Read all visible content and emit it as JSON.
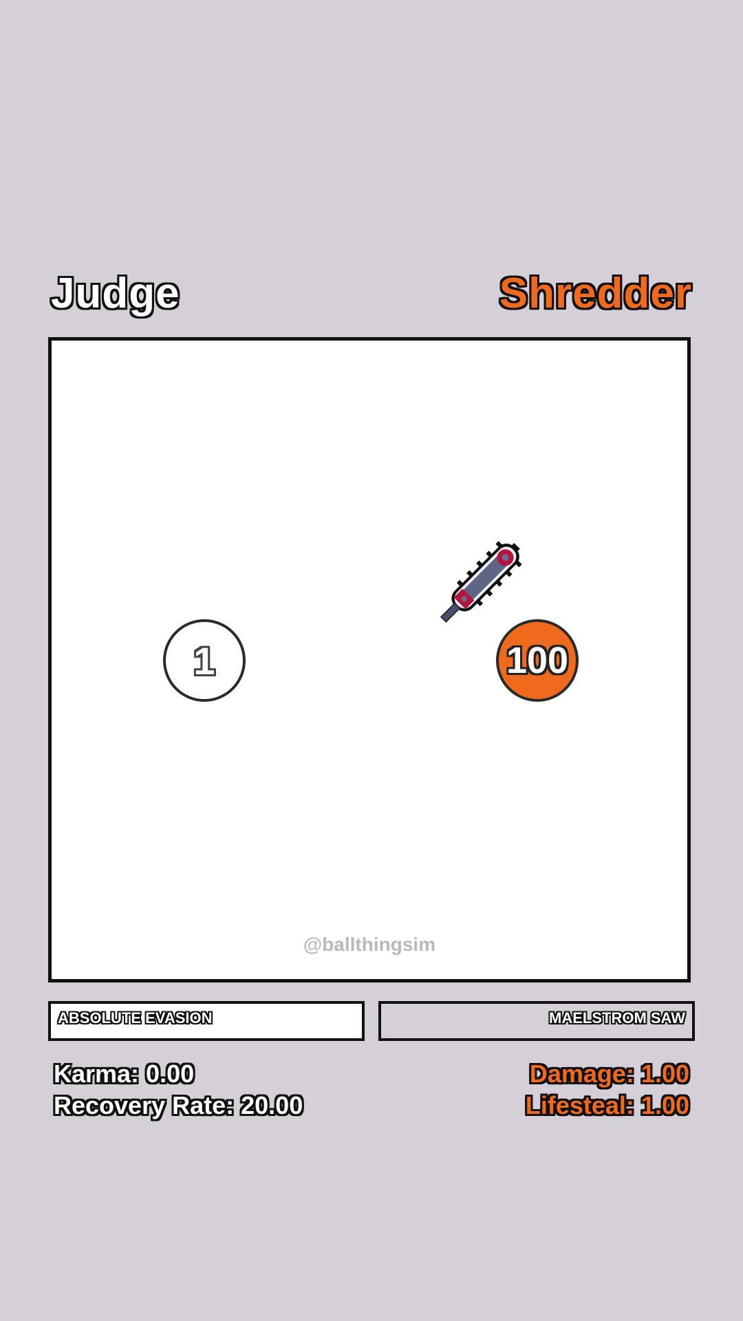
{
  "players": {
    "left": {
      "name": "Judge",
      "ball_value": "1",
      "ability": "ABSOLUTE EVASION",
      "stats": [
        "Karma: 0.00",
        "Recovery Rate: 20.00"
      ],
      "color": "#ffffff"
    },
    "right": {
      "name": "Shredder",
      "ball_value": "100",
      "ability": "MAELSTROM SAW",
      "stats": [
        "Damage: 1.00",
        "Lifesteal: 1.00"
      ],
      "color": "#f06a1e",
      "weapon_icon": "chainsaw-icon"
    }
  },
  "arena": {
    "watermark": "@ballthingsim"
  },
  "colors": {
    "background": "#d5d0d7",
    "arena": "#ffffff",
    "accent": "#f06a1e",
    "outline": "#111111"
  }
}
